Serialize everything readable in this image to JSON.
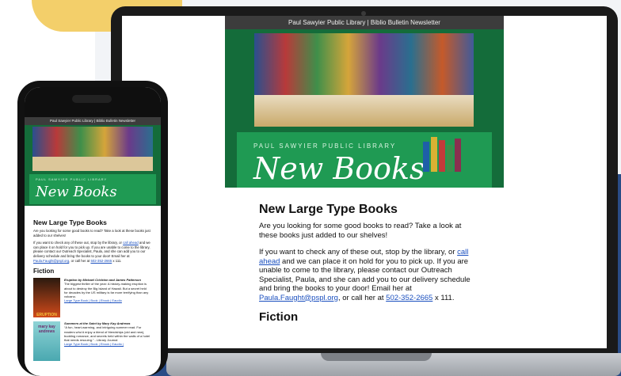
{
  "newsletter": {
    "header": "Paul Sawyier Public Library | Biblio Bulletin Newsletter",
    "hero_kicker": "PAUL SAWYIER PUBLIC LIBRARY",
    "hero_title": "New Books",
    "section_title": "New Large Type Books",
    "intro": "Are you looking for some good books to read? Take a look at these books just added to our shelves!",
    "p2_a": "If you want to check any of these out, stop by the library, or ",
    "p2_link": "call ahead",
    "p2_b": " and we can place it on hold for you to pick up. If you are unable to come to the library, please contact our Outreach Specialist, Paula, and she can add you to our delivery schedule and bring the books to your door! Email her at ",
    "email": "Paula.Faught@pspl.org",
    "p2_c": ", or call her at ",
    "phone": "502-352-2665",
    "p2_d": " x 111.",
    "fiction": "Fiction"
  },
  "phone": {
    "book1_title": "Eruption by Michael Crichton and James Patterson",
    "book1_desc": "The biggest thriller of the year: A history-making eruption is about to destroy the Big Island of Hawaii. But a secret held for decades by the US military is far more terrifying than any volcano.",
    "book1_links": "Large Type Book | Book | Ebook | Eaudio",
    "book1_cover": "ERUPTION",
    "book2_title": "Summers at the Saint by Mary Kay Andrews",
    "book2_desc": "“A fun, heart-warming, and intriguing summer read. For readers who'd enjoy a blend of friendships (old and new), budding romance, and secrets held within the walls of a hotel that needs rescuing.” - Library Journal",
    "book2_links": "Large Type Book | Book | Ebook | Eaudio |",
    "book2_cover": "mary kay andrews"
  },
  "colors": {
    "green": "#146c3a",
    "band": "#1f9a53",
    "link": "#1a4fbf"
  }
}
